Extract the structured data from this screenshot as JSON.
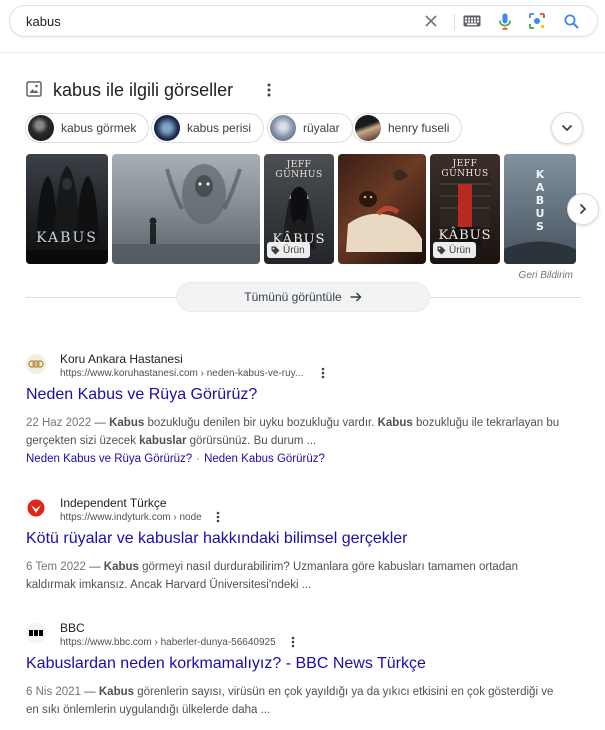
{
  "search": {
    "query": "kabus"
  },
  "images": {
    "title": "kabus ile ilgili görseller",
    "chips": [
      "kabus görmek",
      "kabus perisi",
      "rüyalar",
      "henry fuseli"
    ],
    "product_badge": "Ürün",
    "report_label": "Geri Bildirim",
    "view_all_label": "Tümünü görüntüle",
    "thumb_texts": {
      "t1": "KABUS",
      "t3_author": "JEFF GUNHUS",
      "t3_title": "KÂBUS",
      "t5_author": "JEFF GUNHUS",
      "t5_title": "KÂBUS",
      "t6_title": "KABUS"
    }
  },
  "results": [
    {
      "site": "Koru Ankara Hastanesi",
      "url": "https://www.koruhastanesi.com › neden-kabus-ve-ruy...",
      "title": "Neden Kabus ve Rüya Görürüz?",
      "date": "22 Haz 2022",
      "snippet": [
        {
          "t": " — ",
          "b": false
        },
        {
          "t": "Kabus",
          "b": true
        },
        {
          "t": " bozukluğu denilen bir uyku bozukluğu vardır. ",
          "b": false
        },
        {
          "t": "Kabus",
          "b": true
        },
        {
          "t": " bozukluğu ile tekrarlayan bu gerçekten sizi üzecek ",
          "b": false
        },
        {
          "t": "kabuslar",
          "b": true
        },
        {
          "t": " görürsünüz. Bu durum ...",
          "b": false
        }
      ],
      "sitelinks": [
        "Neden Kabus ve Rüya Görürüz?",
        "Neden Kabus Görürüz?"
      ]
    },
    {
      "site": "Independent Türkçe",
      "url": "https://www.indyturk.com › node",
      "title": "Kötü rüyalar ve kabuslar hakkındaki bilimsel gerçekler",
      "date": "6 Tem 2022",
      "snippet": [
        {
          "t": " — ",
          "b": false
        },
        {
          "t": "Kabus",
          "b": true
        },
        {
          "t": " görmeyi nasıl durdurabilirim? Uzmanlara göre kabusları tamamen ortadan kaldırmak imkansız. Ancak Harvard Üniversitesi'ndeki ...",
          "b": false
        }
      ]
    },
    {
      "site": "BBC",
      "url": "https://www.bbc.com › haberler-dunya-56640925",
      "title": "Kabuslardan neden korkmamalıyız? - BBC News Türkçe",
      "date": "6 Nis 2021",
      "snippet": [
        {
          "t": " — ",
          "b": false
        },
        {
          "t": "Kabus",
          "b": true
        },
        {
          "t": " görenlerin sayısı, virüsün en çok yayıldığı ya da yıkıcı etkisini en çok gösterdiği ve en sıkı önlemlerin uygulandığı ülkelerde daha ...",
          "b": false
        }
      ]
    }
  ]
}
